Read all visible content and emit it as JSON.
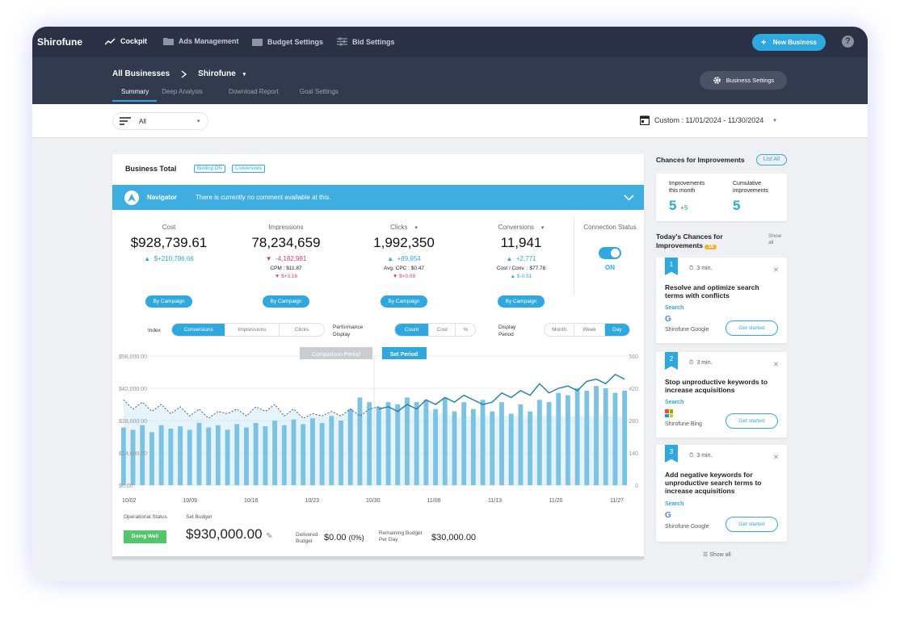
{
  "nav": {
    "logo": "Shirofune",
    "items": [
      {
        "label": "Cockpit",
        "icon": "trend-icon"
      },
      {
        "label": "Ads Management",
        "icon": "folder-icon"
      },
      {
        "label": "Budget Settings",
        "icon": "wallet-icon"
      },
      {
        "label": "Bid Settings",
        "icon": "sliders-icon"
      }
    ],
    "new_business": "New Business",
    "help": "?"
  },
  "header": {
    "crumb_root": "All Businesses",
    "crumb_current": "Shirofune",
    "tabs": [
      "Summary",
      "Deep Analysis",
      "Download Report",
      "Goal Settings"
    ],
    "business_settings": "Business Settings"
  },
  "filter": {
    "value": "All",
    "date_range": "Custom : 11/01/2024 - 11/30/2024"
  },
  "business_total": {
    "title": "Business Total",
    "badges": [
      "Bidding ON",
      "Conversions"
    ],
    "navigator_label": "Navigator",
    "navigator_text": "There is currently no comment available at this."
  },
  "metrics": [
    {
      "label": "Cost",
      "value": "$928,739.61",
      "change": "$+210,796.66",
      "dir": "up",
      "sub": "",
      "sub_change": "",
      "sub_dir": "",
      "button": "By Campaign"
    },
    {
      "label": "Impressions",
      "value": "78,234,659",
      "change": "-4,182,981",
      "dir": "down",
      "sub": "CPM : $11.87",
      "sub_change": "$+3.16",
      "sub_dir": "down",
      "button": "By Campaign"
    },
    {
      "label": "Clicks",
      "value": "1,992,350",
      "change": "+89,954",
      "dir": "up",
      "sub": "Avg. CPC : $0.47",
      "sub_change": "$+0.09",
      "sub_dir": "down",
      "button": "By Campaign"
    },
    {
      "label": "Conversions",
      "value": "11,941",
      "change": "+2,771",
      "dir": "up",
      "sub": "Cost / Conv. : $77.78",
      "sub_change": "$-0.51",
      "sub_dir": "up",
      "button": "By Campaign"
    }
  ],
  "connection": {
    "label": "Connection Status",
    "state": "ON"
  },
  "controls": {
    "index_label": "Index",
    "index_options": [
      "Conversions",
      "Impressions",
      "Clicks"
    ],
    "perf_label_1": "Performance",
    "perf_label_2": "Display",
    "perf_options": [
      "Count",
      "Cost",
      "%"
    ],
    "period_label_1": "Display",
    "period_label_2": "Period",
    "period_options": [
      "Month",
      "Week",
      "Day"
    ]
  },
  "chart_data": {
    "type": "bar",
    "title": "",
    "yleft_ticks": [
      "$56,000.00",
      "$42,000.00",
      "$28,000.00",
      "$14,000.00",
      "$0.00"
    ],
    "yright_ticks": [
      "560",
      "420",
      "280",
      "140",
      "0"
    ],
    "x_ticks": [
      "10/02",
      "10/09",
      "10/16",
      "10/23",
      "10/30",
      "11/06",
      "11/13",
      "11/20",
      "11/27"
    ],
    "comparison_label": "Comparison Period",
    "set_label": "Set Period",
    "ylim_left": [
      0,
      56000
    ],
    "ylim_right": [
      0,
      560
    ],
    "bars": [
      250,
      240,
      260,
      230,
      260,
      245,
      255,
      240,
      270,
      250,
      260,
      240,
      265,
      250,
      270,
      255,
      280,
      260,
      285,
      265,
      290,
      270,
      300,
      280,
      330,
      380,
      360,
      340,
      360,
      350,
      380,
      360,
      370,
      330,
      380,
      320,
      360,
      330,
      370,
      320,
      360,
      310,
      350,
      320,
      370,
      360,
      400,
      390,
      420,
      410,
      430,
      420,
      400,
      410
    ],
    "conv_line": [
      370,
      330,
      360,
      320,
      350,
      310,
      340,
      300,
      330,
      290,
      320,
      310,
      330,
      300,
      340,
      320,
      350,
      300,
      330,
      290,
      310,
      300,
      320,
      300,
      330,
      300,
      330,
      340,
      310,
      350,
      330,
      320,
      340,
      300,
      320,
      290,
      300,
      300,
      300,
      300,
      300,
      300,
      300,
      300,
      300,
      300,
      300,
      300,
      300,
      300,
      300,
      300,
      300,
      300
    ],
    "period_line": [
      0,
      0,
      0,
      0,
      0,
      0,
      0,
      0,
      0,
      0,
      0,
      0,
      0,
      0,
      0,
      0,
      0,
      0,
      0,
      0,
      0,
      0,
      0,
      0,
      0,
      0,
      0,
      330,
      340,
      320,
      350,
      330,
      370,
      350,
      380,
      360,
      390,
      370,
      350,
      360,
      400,
      380,
      410,
      390,
      440,
      400,
      420,
      430,
      410,
      450,
      460,
      440,
      480,
      460
    ]
  },
  "budget": {
    "op_status_label": "Operational Status",
    "op_status": "Doing Well",
    "set_budget_label": "Set Budget",
    "set_budget": "$930,000.00",
    "delivered_label_1": "Delivered",
    "delivered_label_2": "Budget",
    "delivered": "$0.00",
    "delivered_pct": "(0%)",
    "remaining_label_1": "Remaining Budget",
    "remaining_label_2": "Per Day",
    "remaining": "$30,000.00"
  },
  "improvements": {
    "title": "Chances for Improvements",
    "list_all": "List All",
    "this_month_label_1": "Improvements",
    "this_month_label_2": "this month",
    "this_month": "5",
    "this_month_delta": "+5",
    "cumulative_label_1": "Cumulative",
    "cumulative_label_2": "improvements",
    "cumulative": "5",
    "today_title_1": "Today's Chances for",
    "today_title_2": "Improvements",
    "today_count": "16",
    "show_all_1": "Show",
    "show_all_2": "all",
    "cards": [
      {
        "num": "1",
        "time": "3 min.",
        "title": "Resolve and optimize search terms with conflicts",
        "channel": "Search",
        "source": "Shirofune Google",
        "logo": "google-icon",
        "button": "Get started"
      },
      {
        "num": "2",
        "time": "3 min.",
        "title": "Stop unproductive keywords to increase acquisitions",
        "channel": "Search",
        "source": "Shirofune Bing",
        "logo": "microsoft-icon",
        "button": "Get started"
      },
      {
        "num": "3",
        "time": "3 min.",
        "title": "Add negative keywords for unproductive search terms to increase acquisitions",
        "channel": "Search",
        "source": "Shirofune Google",
        "logo": "google-icon",
        "button": "Get started"
      }
    ],
    "show_all_bottom": "Show all"
  }
}
